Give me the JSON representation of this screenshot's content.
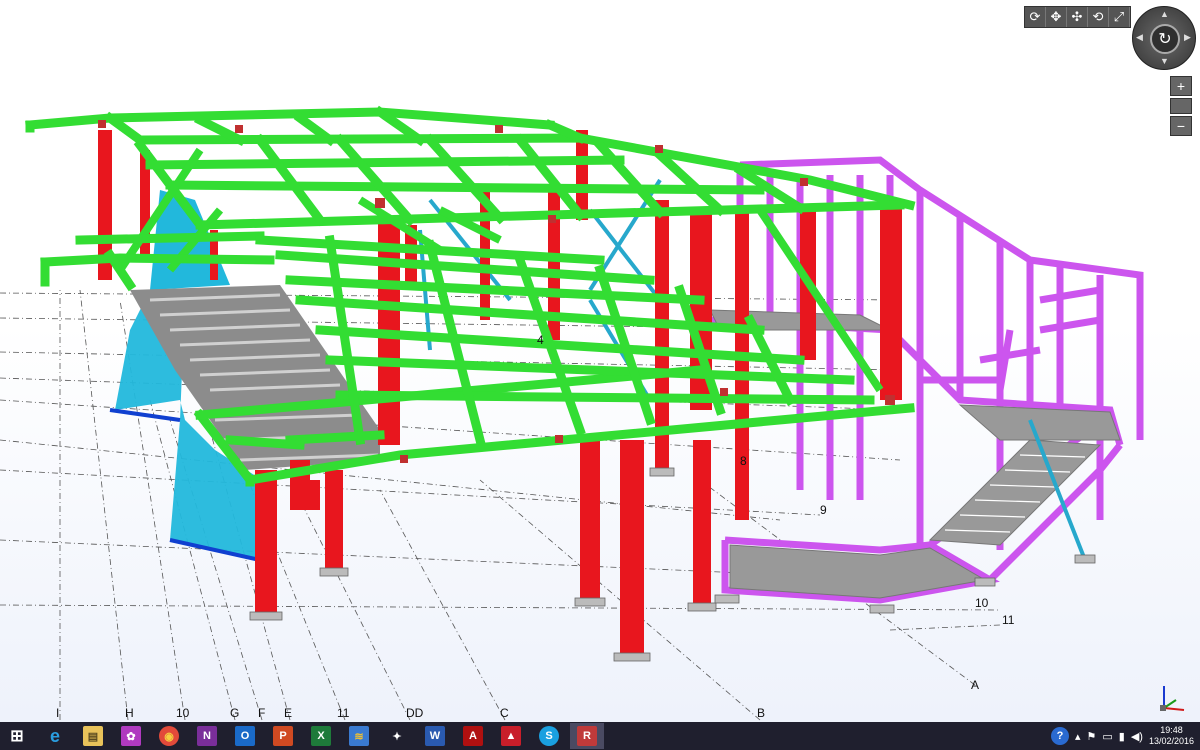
{
  "viewport": {
    "grid_labels": {
      "bottom": [
        "I",
        "H",
        "10",
        "G",
        "F",
        "E",
        "11",
        "DD",
        "C",
        "B"
      ],
      "right": [
        "10",
        "11",
        "A"
      ],
      "interior": [
        "8",
        "9",
        "4"
      ]
    }
  },
  "view_toolbar": {
    "buttons": [
      "rotate-3d",
      "pan",
      "pan-zoom",
      "orbit",
      "fit-view"
    ]
  },
  "zoom": {
    "plus": "+",
    "minus": "−"
  },
  "taskbar": {
    "apps": [
      {
        "name": "start",
        "label": "⊞"
      },
      {
        "name": "internet-explorer",
        "label": "e"
      },
      {
        "name": "file-explorer",
        "label": "▤"
      },
      {
        "name": "photo-app",
        "label": "✿"
      },
      {
        "name": "chrome",
        "label": "◉"
      },
      {
        "name": "onenote",
        "label": "N"
      },
      {
        "name": "outlook",
        "label": "O"
      },
      {
        "name": "powerpoint",
        "label": "P"
      },
      {
        "name": "excel",
        "label": "X"
      },
      {
        "name": "layers-app",
        "label": "≋"
      },
      {
        "name": "inkscape",
        "label": "✦"
      },
      {
        "name": "word",
        "label": "W"
      },
      {
        "name": "acrobat",
        "label": "A"
      },
      {
        "name": "autodesk",
        "label": "▲"
      },
      {
        "name": "skype",
        "label": "S"
      },
      {
        "name": "robot-structural",
        "label": "R"
      }
    ],
    "tray": {
      "help": "?",
      "time": "19:48",
      "date": "13/02/2016"
    }
  },
  "colors": {
    "beam": "#33dd33",
    "column": "#e8161e",
    "stair": "#cc55ee",
    "brace": "#27a8cc",
    "deck": "#9a9a9a",
    "wall": "#22b8dc"
  }
}
